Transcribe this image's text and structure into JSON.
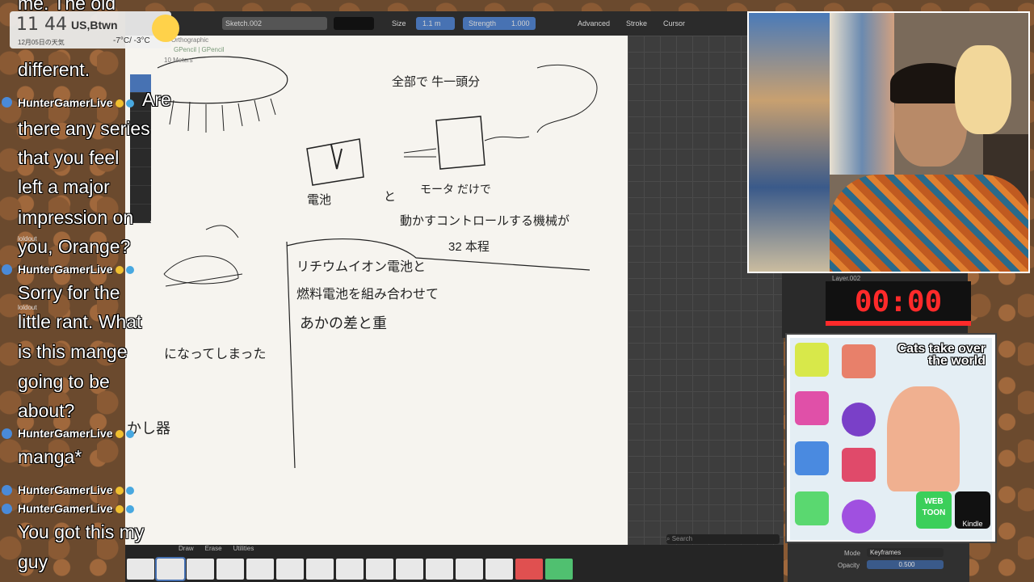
{
  "clock": {
    "time": "11 44",
    "location": "US,Btwn",
    "date": "12月05日の天気",
    "temps": "-7°C/ -3°C"
  },
  "blender": {
    "object_name": "Sketch.002",
    "size_label": "Size",
    "size_value": "1.1 m",
    "strength_label": "Strength",
    "strength_value": "1.000",
    "advanced_label": "Advanced",
    "stroke_label": "Stroke",
    "cursor_label": "Cursor",
    "viewport_label": "ht Orthographic",
    "viewport_sub": "GPencil | GPencil",
    "viewport_scale": "10 Meters",
    "mode_tabs": [
      "Draw",
      "Erase",
      "Utilities"
    ],
    "search_placeholder": "Search"
  },
  "sketch_texts": {
    "line1": "全部で 牛一頭分",
    "battery": "電池",
    "to": "と",
    "motor": "モータ だけで",
    "control": "動かすコントロールする機械が",
    "count": "32 本程",
    "li": "リチウムイオン電池と",
    "fuel": "燃料電池を組み合わせて",
    "diff": "あかの差と重",
    "became": "になってしまった",
    "vessel": "かし器"
  },
  "chat": {
    "top_fragment": "me. The old",
    "msg1": [
      "different."
    ],
    "user1": "HunterGamerLive",
    "msg2": [
      "Are",
      "there any series",
      "that you feel",
      "left a major",
      "impression on",
      "you, Orange?"
    ],
    "user2": "HunterGamerLive",
    "msg3": [
      "Sorry for the",
      "little rant. What",
      "is this mange",
      "going to be",
      "about?"
    ],
    "user3": "HunterGamerLive",
    "msg4": [
      "manga*"
    ],
    "user4": "HunterGamerLive",
    "user5": "HunterGamerLive",
    "msg5": [
      "You got this my",
      "guy"
    ],
    "sys1": "loldout",
    "sys2": "loldout"
  },
  "timer": {
    "layer": "Layer.002",
    "display": "00:00"
  },
  "promo": {
    "title": "Cats take over the world",
    "webtoon": "WEB TOON",
    "kindle": "Kindle"
  },
  "props": {
    "mode_label": "Mode",
    "mode_value": "Keyframes",
    "opacity_label": "Opacity",
    "opacity_value": "0.500"
  },
  "colors": {
    "accent": "#4772b3",
    "timer_red": "#ff2a2a"
  }
}
